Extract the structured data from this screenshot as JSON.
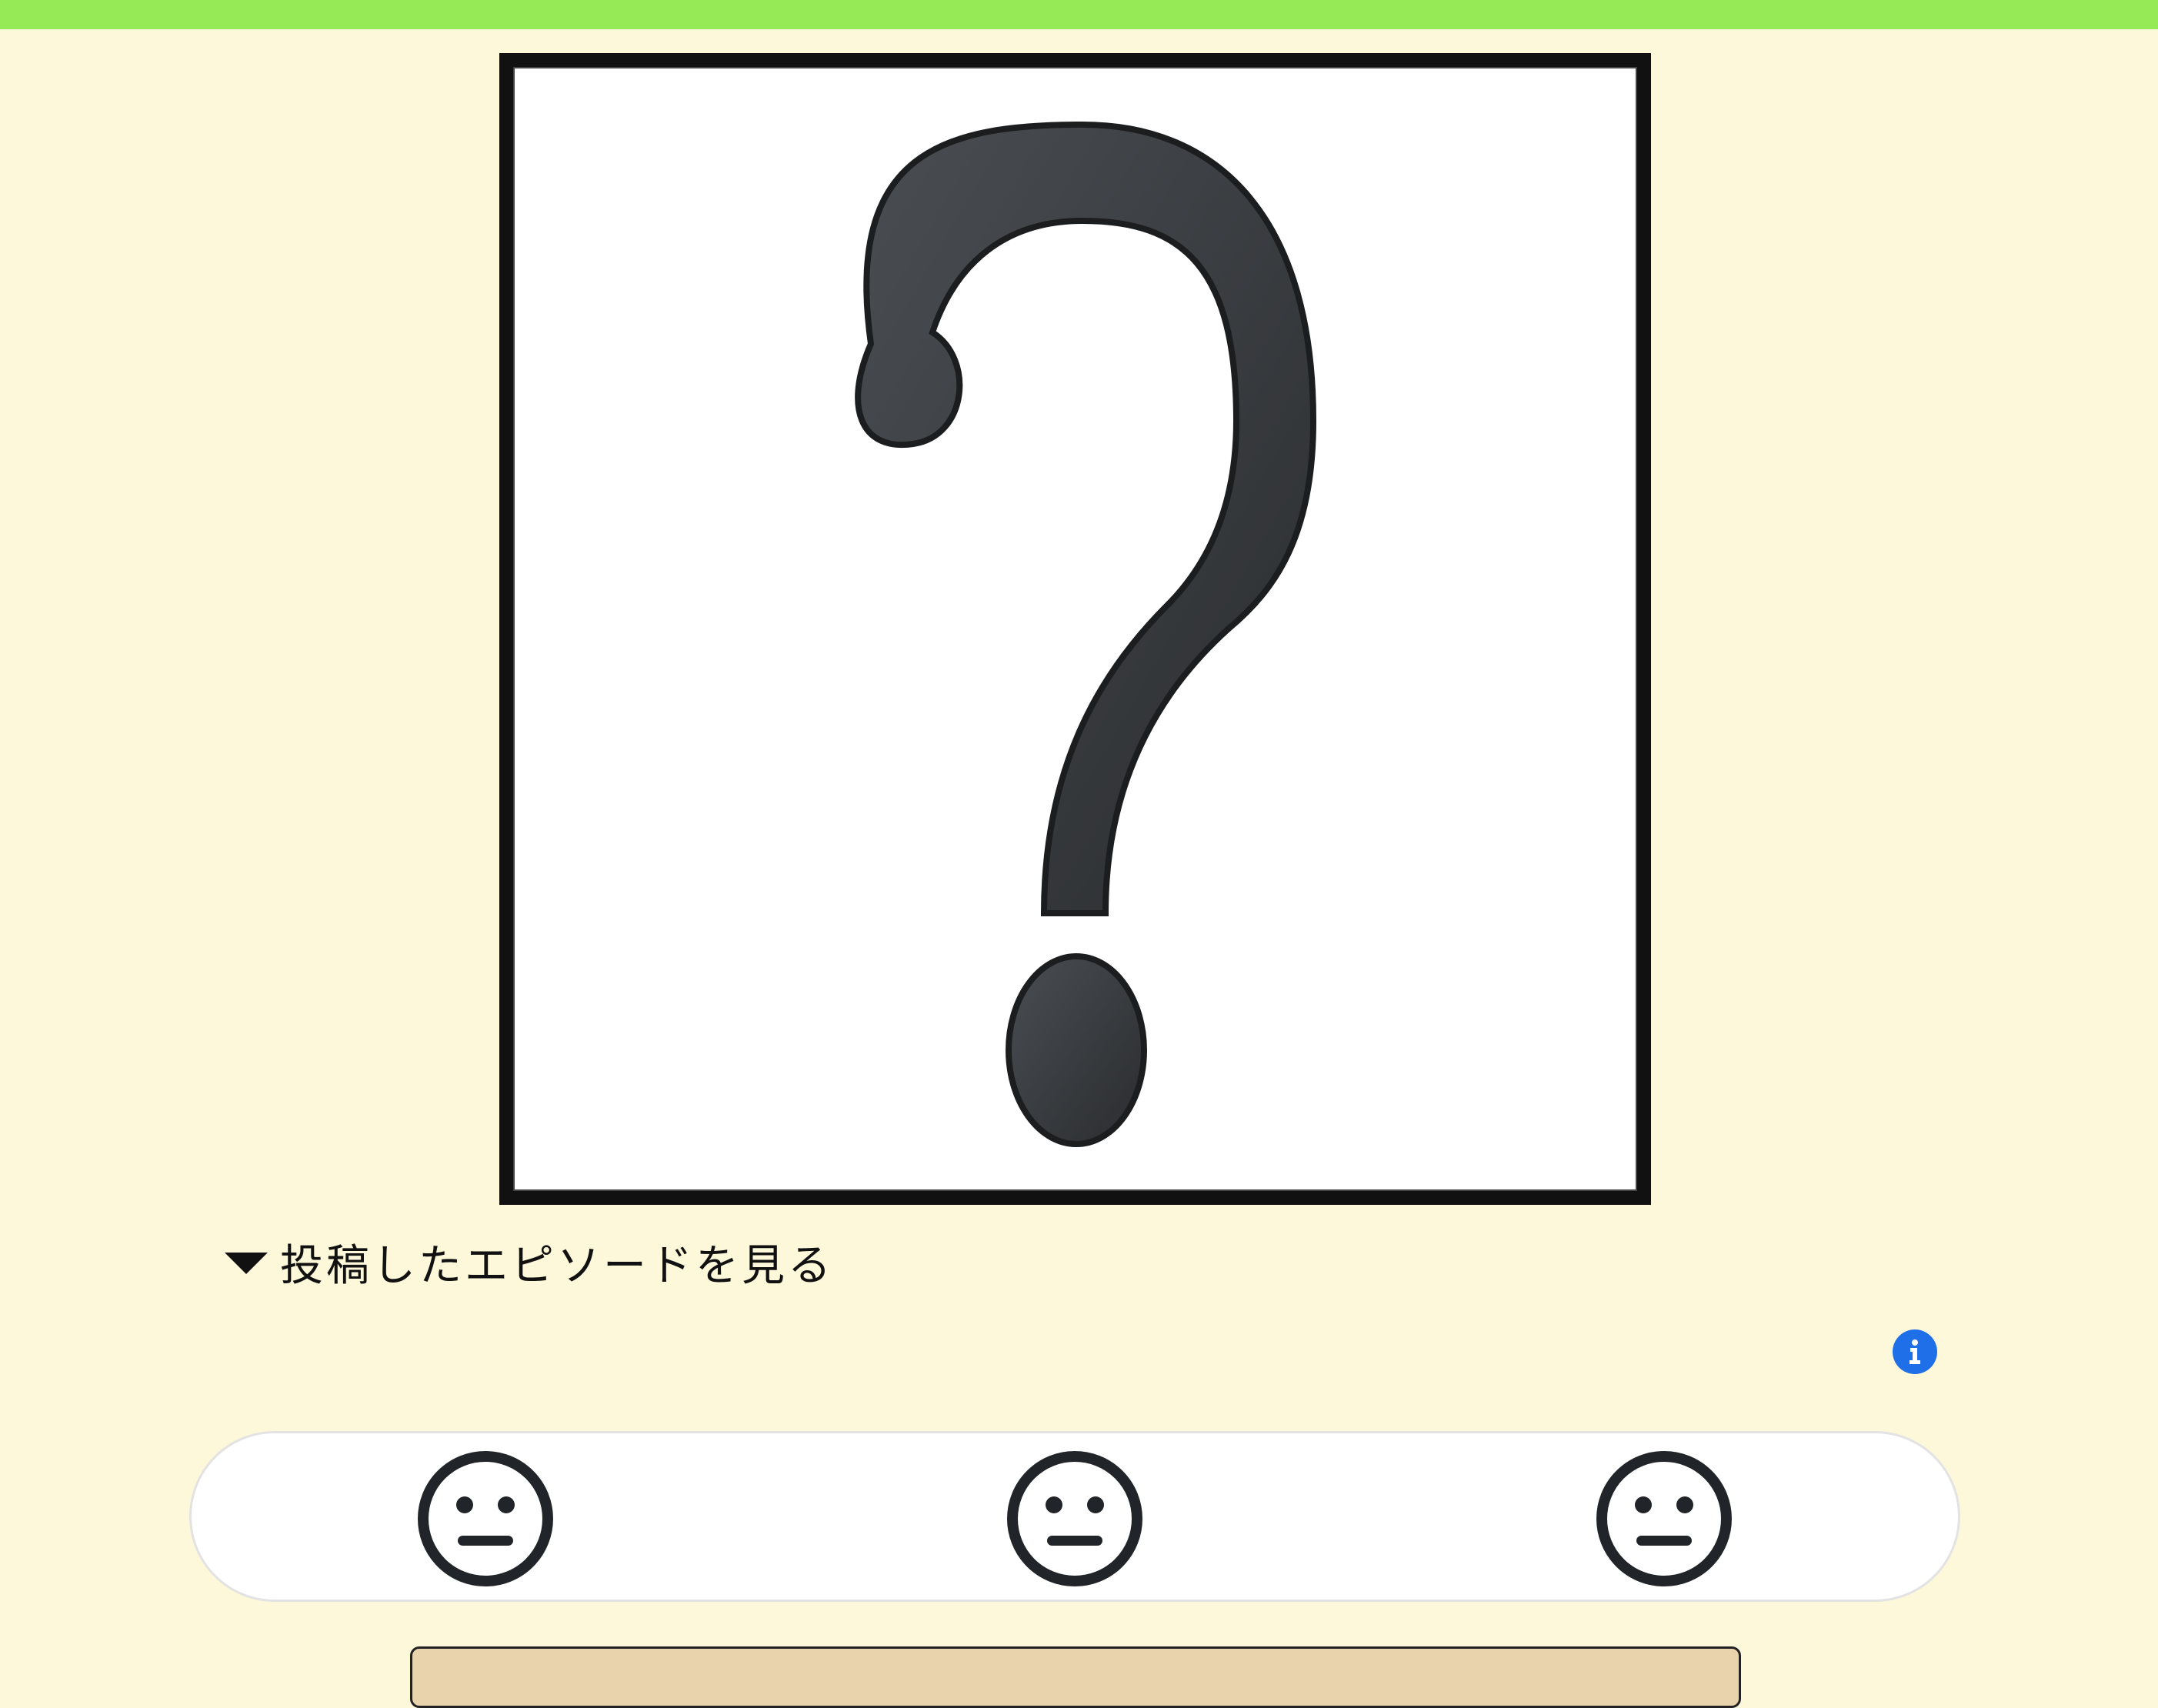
{
  "header": {
    "bar_color": "#95ea55"
  },
  "image": {
    "alt": "?",
    "icon": "question-mark-icon"
  },
  "episode": {
    "toggle_label": "投稿したエピソードを見る",
    "icon": "caret-down-icon"
  },
  "info": {
    "icon": "info-icon",
    "color": "#1f6fe8"
  },
  "reactions": [
    {
      "icon": "neutral-face-icon"
    },
    {
      "icon": "neutral-face-icon"
    },
    {
      "icon": "neutral-face-icon"
    }
  ],
  "colors": {
    "background": "#fdf8d9",
    "panel": "#e8d3ad"
  }
}
